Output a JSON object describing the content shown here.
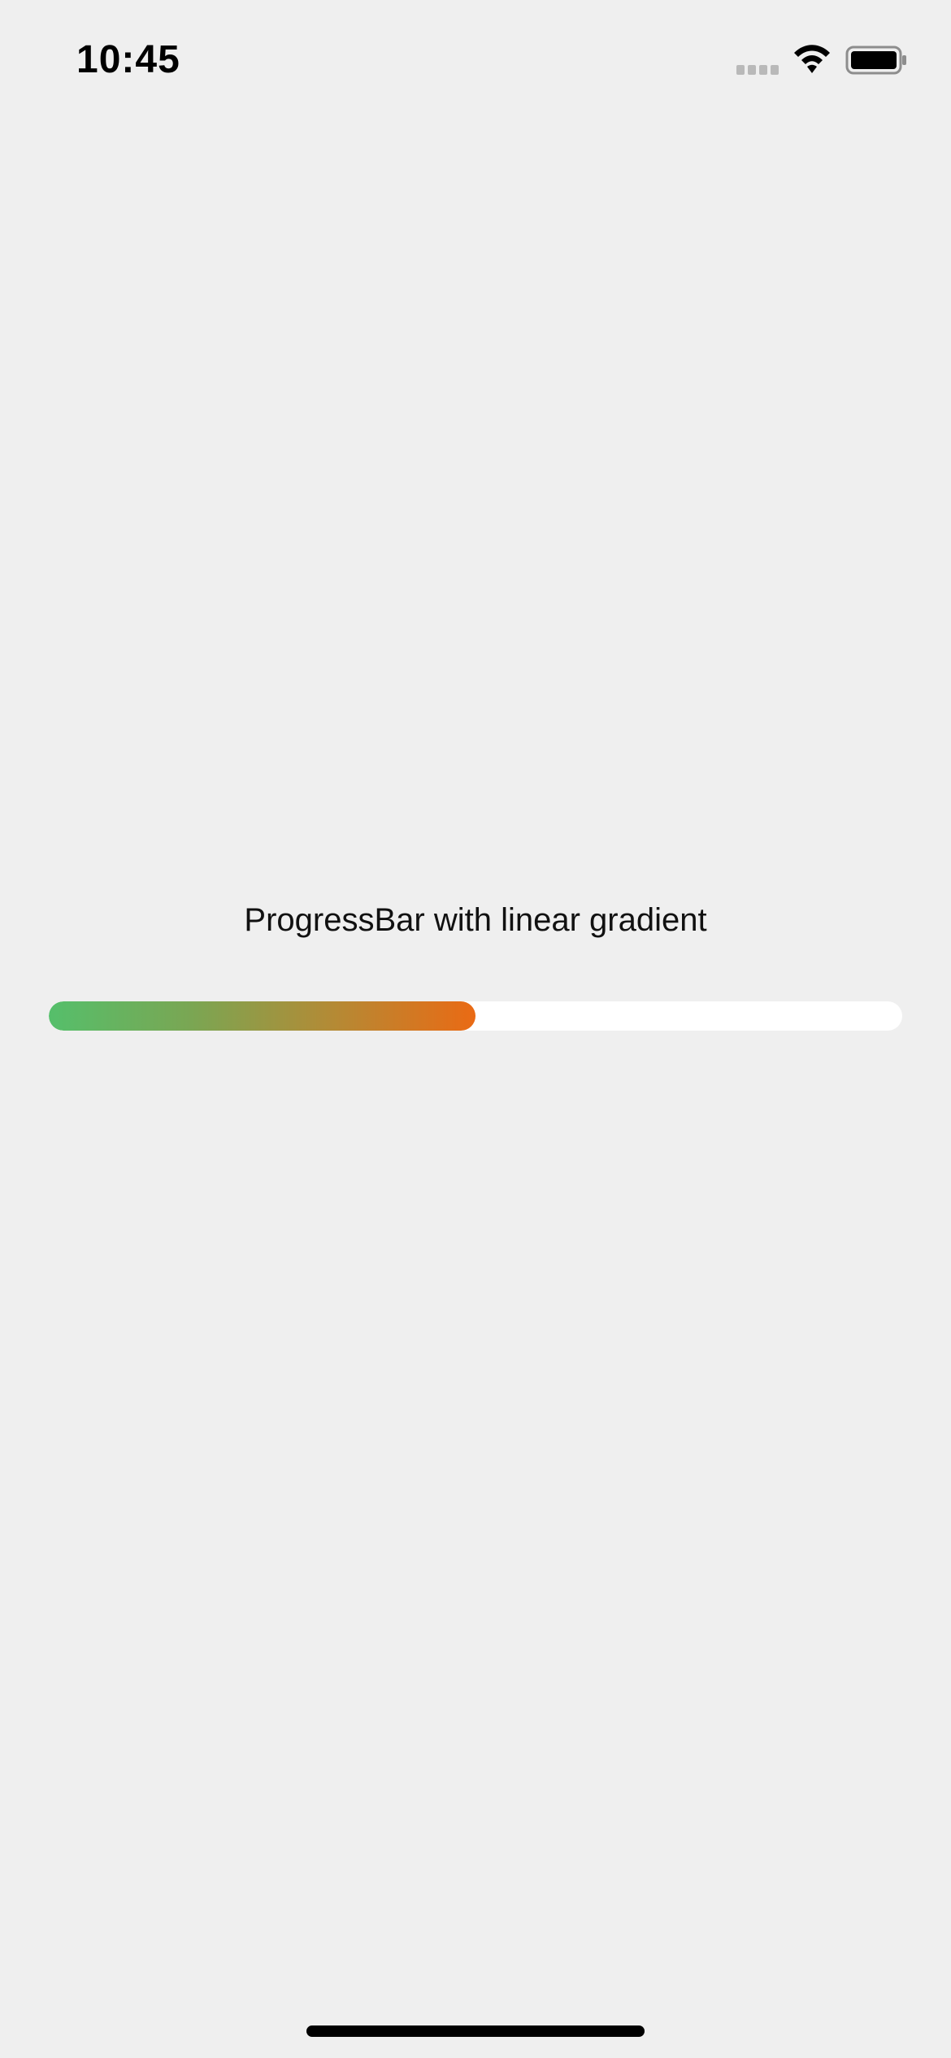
{
  "status_bar": {
    "time": "10:45",
    "icons": [
      "signal-icon",
      "wifi-icon",
      "battery-icon"
    ]
  },
  "main": {
    "caption": "ProgressBar with linear gradient",
    "progress": {
      "value": 0.5,
      "gradient_colors": [
        "#55bf6b",
        "#7aa653",
        "#b48a35",
        "#ea6a14"
      ],
      "track_color": "#ffffff"
    }
  },
  "colors": {
    "background": "#efefef",
    "text": "#111111"
  }
}
